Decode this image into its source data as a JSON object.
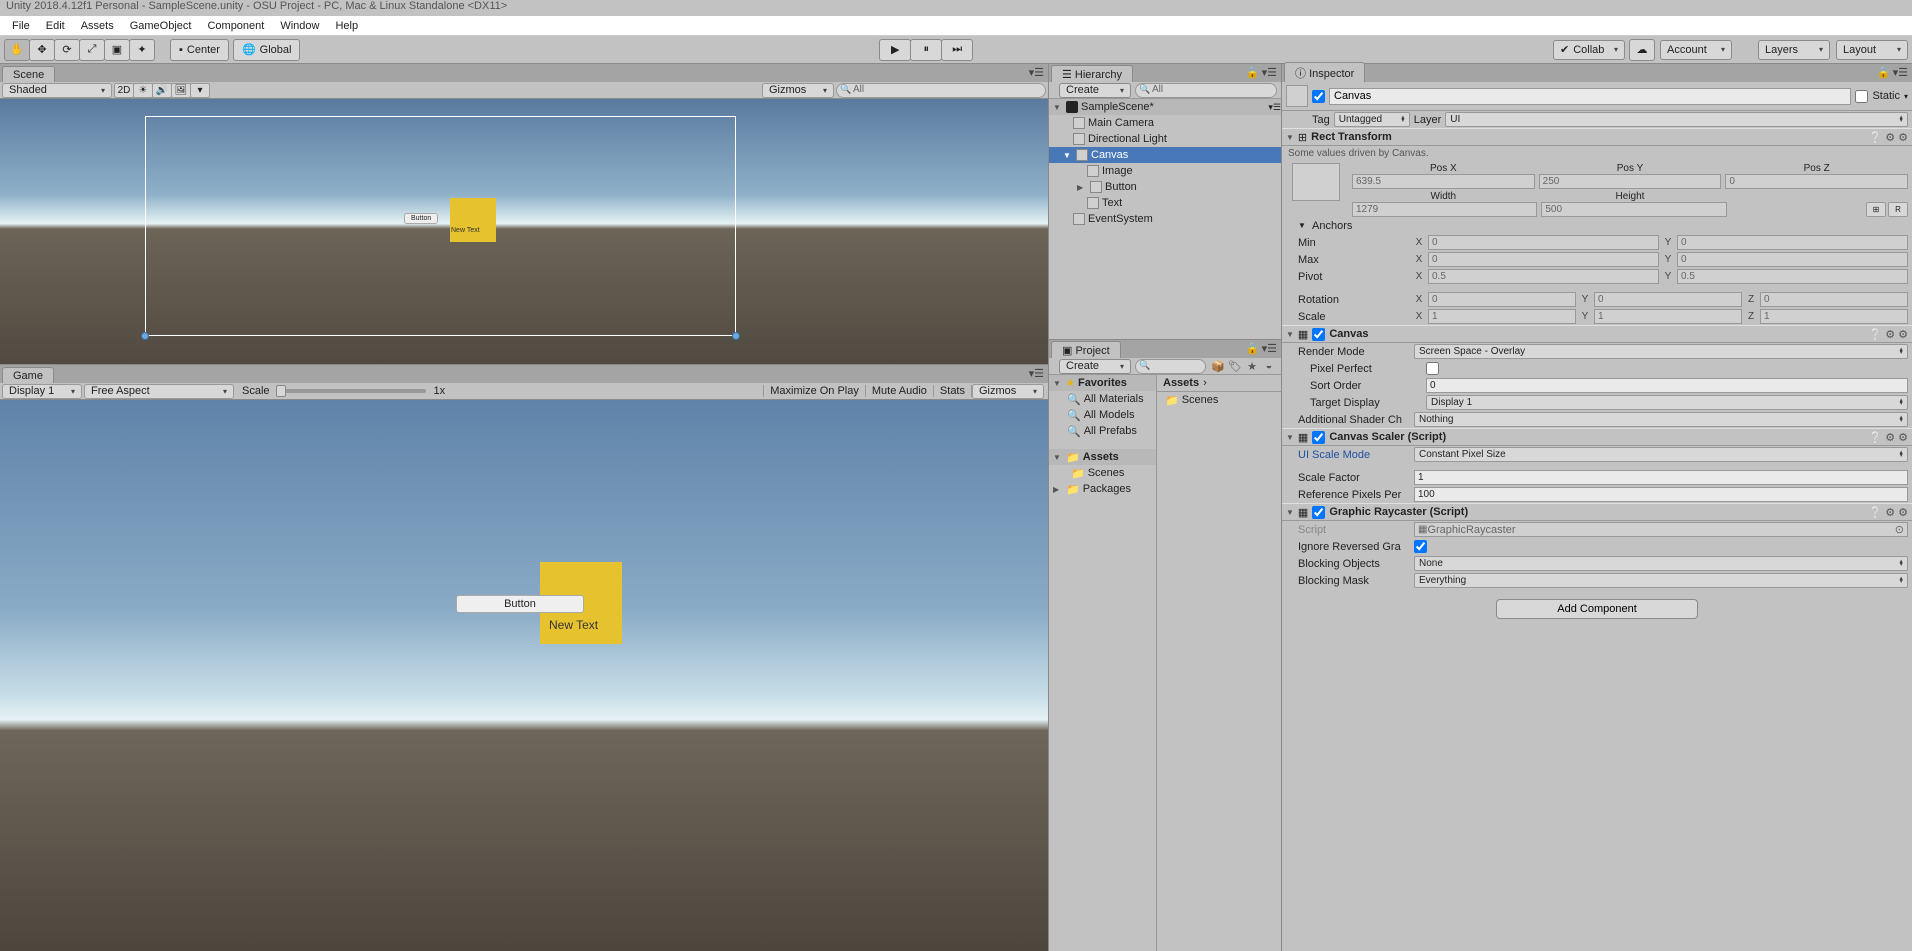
{
  "title": "Unity 2018.4.12f1 Personal - SampleScene.unity - OSU Project - PC, Mac & Linux Standalone <DX11>",
  "menu": [
    "File",
    "Edit",
    "Assets",
    "GameObject",
    "Component",
    "Window",
    "Help"
  ],
  "toolbar": {
    "center": "Center",
    "global": "Global",
    "collab": "Collab",
    "account": "Account",
    "layers": "Layers",
    "layout": "Layout"
  },
  "scene": {
    "tab": "Scene",
    "shadeMode": "Shaded",
    "twoD": "2D",
    "gizmos": "Gizmos",
    "searchPlaceholder": "All",
    "miniButtonLabel": "Button",
    "miniNewText": "New Text"
  },
  "game": {
    "tab": "Game",
    "display": "Display 1",
    "aspect": "Free Aspect",
    "scaleLabel": "Scale",
    "scaleVal": "1x",
    "maximize": "Maximize On Play",
    "mute": "Mute Audio",
    "stats": "Stats",
    "gizmos": "Gizmos",
    "buttonLabel": "Button",
    "newText": "New Text"
  },
  "hierarchy": {
    "tab": "Hierarchy",
    "create": "Create",
    "searchPlaceholder": "All",
    "sceneName": "SampleScene*",
    "items": [
      {
        "name": "Main Camera",
        "indent": 2
      },
      {
        "name": "Directional Light",
        "indent": 2
      },
      {
        "name": "Canvas",
        "indent": 2,
        "sel": true,
        "fold": "▼"
      },
      {
        "name": "Image",
        "indent": 3
      },
      {
        "name": "Button",
        "indent": 3,
        "fold": "▶"
      },
      {
        "name": "Text",
        "indent": 3
      },
      {
        "name": "EventSystem",
        "indent": 2
      }
    ]
  },
  "project": {
    "tab": "Project",
    "create": "Create",
    "favorites": "Favorites",
    "allMaterials": "All Materials",
    "allModels": "All Models",
    "allPrefabs": "All Prefabs",
    "assets": "Assets",
    "scenesFolder": "Scenes",
    "packages": "Packages",
    "breadcrumb": "Assets",
    "contentItem": "Scenes"
  },
  "inspector": {
    "tab": "Inspector",
    "name": "Canvas",
    "static": "Static",
    "tagLabel": "Tag",
    "tag": "Untagged",
    "layerLabel": "Layer",
    "layer": "UI",
    "rectTransform": {
      "header": "Rect Transform",
      "note": "Some values driven by Canvas.",
      "posXL": "Pos X",
      "posYL": "Pos Y",
      "posZL": "Pos Z",
      "posX": "639.5",
      "posY": "250",
      "posZ": "0",
      "widthL": "Width",
      "heightL": "Height",
      "width": "1279",
      "height": "500",
      "anchors": "Anchors",
      "minL": "Min",
      "minX": "0",
      "minY": "0",
      "maxL": "Max",
      "maxX": "0",
      "maxY": "0",
      "pivotL": "Pivot",
      "pivotX": "0.5",
      "pivotY": "0.5",
      "rotL": "Rotation",
      "rotX": "0",
      "rotY": "0",
      "rotZ": "0",
      "scaleL": "Scale",
      "scaleX": "1",
      "scaleY": "1",
      "scaleZ": "1",
      "rBtn": "R"
    },
    "canvasComp": {
      "header": "Canvas",
      "renderModeL": "Render Mode",
      "renderMode": "Screen Space - Overlay",
      "pixelPerfectL": "Pixel Perfect",
      "sortOrderL": "Sort Order",
      "sortOrder": "0",
      "targetDisplayL": "Target Display",
      "targetDisplay": "Display 1",
      "addShaderL": "Additional Shader Ch",
      "addShader": "Nothing"
    },
    "scaler": {
      "header": "Canvas Scaler (Script)",
      "uiScaleModeL": "UI Scale Mode",
      "uiScaleMode": "Constant Pixel Size",
      "scaleFactorL": "Scale Factor",
      "scaleFactor": "1",
      "refPixelsL": "Reference Pixels Per",
      "refPixels": "100"
    },
    "raycaster": {
      "header": "Graphic Raycaster (Script)",
      "scriptL": "Script",
      "script": "GraphicRaycaster",
      "ignoreRevL": "Ignore Reversed Gra",
      "blockObjL": "Blocking Objects",
      "blockObj": "None",
      "blockMaskL": "Blocking Mask",
      "blockMask": "Everything"
    },
    "addComponent": "Add Component"
  }
}
